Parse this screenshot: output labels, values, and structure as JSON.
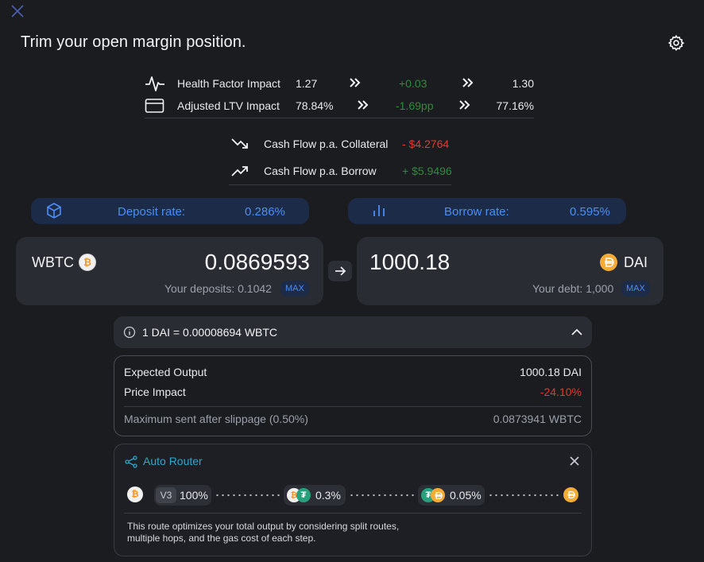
{
  "header": {
    "title": "Trim your open margin position."
  },
  "impacts": [
    {
      "label": "Health Factor Impact",
      "before": "1.27",
      "delta": "+0.03",
      "after": "1.30"
    },
    {
      "label": "Adjusted LTV Impact",
      "before": "78.84%",
      "delta": "-1.69pp",
      "after": "77.16%"
    }
  ],
  "cash_flows": [
    {
      "label": "Cash Flow p.a. Collateral",
      "value": "- $4.2764",
      "color": "#e8362b"
    },
    {
      "label": "Cash Flow p.a. Borrow",
      "value": "+ $5.9496",
      "color": "#2e8b3a"
    }
  ],
  "rates": {
    "deposit": {
      "label": "Deposit rate:",
      "value": "0.286%"
    },
    "borrow": {
      "label": "Borrow rate:",
      "value": "0.595%"
    }
  },
  "from_token": {
    "symbol": "WBTC",
    "amount": "0.0869593",
    "sub_text": "Your deposits: 0.1042",
    "max_label": "MAX"
  },
  "to_token": {
    "symbol": "DAI",
    "amount": "1000.18",
    "sub_text": "Your debt: 1,000",
    "max_label": "MAX"
  },
  "exchange_rate": "1 DAI = 0.00008694 WBTC",
  "details": {
    "expected_output_label": "Expected Output",
    "expected_output_value": "1000.18 DAI",
    "price_impact_label": "Price Impact",
    "price_impact_value": "-24.10%",
    "price_impact_color": "#e8362b",
    "max_sent_label": "Maximum sent after slippage (0.50%)",
    "max_sent_value": "0.0873941 WBTC"
  },
  "router": {
    "title": "Auto Router",
    "version_badge": "V3",
    "route_share": "100%",
    "hop1_fee": "0.3%",
    "hop2_fee": "0.05%",
    "note_line1": "This route optimizes your total output by considering split routes,",
    "note_line2": "multiple hops, and the gas cost of each step."
  },
  "colors": {
    "accent_blue": "#4c8df6",
    "positive": "#2e8b3a",
    "negative": "#e8362b",
    "router_teal": "#2ea6c9",
    "btc_orange": "#f7931a",
    "dai_yellow": "#f5ac37",
    "usdt_green": "#26a17b"
  },
  "icons": [
    "close-icon",
    "gear-icon",
    "pulse-icon",
    "card-icon",
    "double-chevron-icon",
    "trend-down-icon",
    "trend-up-icon",
    "cube-icon",
    "bar-chart-icon",
    "arrow-right-icon",
    "info-icon",
    "chevron-up-icon",
    "route-icon",
    "btc-icon",
    "dai-icon",
    "usdt-icon"
  ]
}
